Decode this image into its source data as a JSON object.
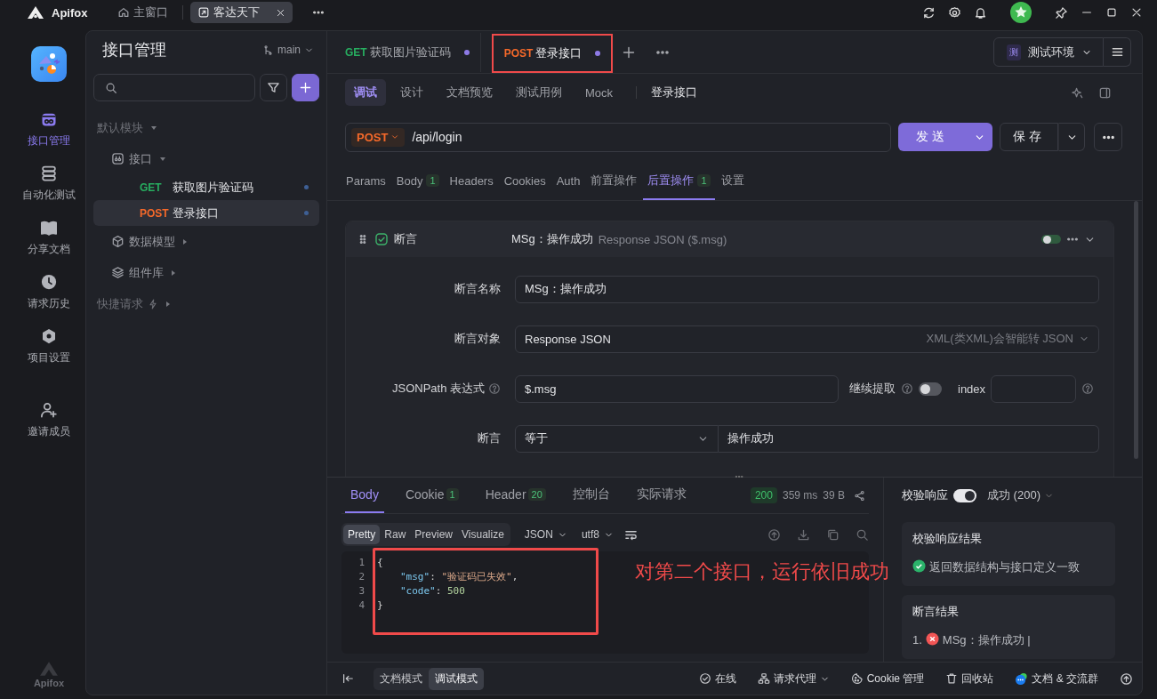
{
  "titlebar": {
    "app_name": "Apifox",
    "tabs": [
      {
        "label": "主窗口",
        "kind": "home",
        "selected": false,
        "closable": false
      },
      {
        "label": "客达天下",
        "kind": "project",
        "selected": true,
        "closable": true
      }
    ]
  },
  "rail": {
    "items": [
      {
        "label": "接口管理",
        "kind": "api",
        "selected": true
      },
      {
        "label": "自动化测试",
        "kind": "automation",
        "selected": false
      },
      {
        "label": "分享文档",
        "kind": "docs",
        "selected": false
      },
      {
        "label": "请求历史",
        "kind": "history",
        "selected": false
      },
      {
        "label": "项目设置",
        "kind": "settings",
        "selected": false
      },
      {
        "label": "邀请成员",
        "kind": "invite",
        "selected": false
      }
    ],
    "footer": "Apifox"
  },
  "sidebar": {
    "title": "接口管理",
    "branch": "main",
    "tree": [
      {
        "label": "默认模块",
        "kind": "module",
        "expanded": true,
        "children": [
          {
            "label": "接口",
            "kind": "folder",
            "expanded": true,
            "children": [
              {
                "label": "获取图片验证码",
                "kind": "endpoint",
                "method": "GET",
                "color": "#27ae60",
                "selected": false
              },
              {
                "label": "登录接口",
                "kind": "endpoint",
                "method": "POST",
                "color": "#f5692a",
                "selected": true
              }
            ]
          },
          {
            "label": "数据模型",
            "kind": "models",
            "expanded": false
          },
          {
            "label": "组件库",
            "kind": "components",
            "expanded": false
          }
        ]
      },
      {
        "label": "快捷请求",
        "kind": "quick",
        "expanded": false
      }
    ]
  },
  "request_tabs": [
    {
      "method": "GET",
      "color": "#27ae60",
      "label": "获取图片验证码",
      "selected": false,
      "unsaved": true,
      "highlighted": false
    },
    {
      "method": "POST",
      "color": "#f5692a",
      "label": "登录接口",
      "selected": true,
      "unsaved": true,
      "highlighted": true
    }
  ],
  "environment": {
    "badge": "测",
    "label": "测试环境"
  },
  "view_tabs": [
    {
      "label": "调试",
      "selected": true
    },
    {
      "label": "设计",
      "selected": false
    },
    {
      "label": "文档预览",
      "selected": false
    },
    {
      "label": "测试用例",
      "selected": false
    },
    {
      "label": "Mock",
      "selected": false
    }
  ],
  "endpoint_name": "登录接口",
  "request": {
    "method": "POST",
    "color": "#f5692a",
    "url": "/api/login",
    "send": "发送",
    "save": "保存"
  },
  "param_tabs": [
    {
      "label": "Params",
      "selected": false
    },
    {
      "label": "Body",
      "count": "1",
      "selected": false
    },
    {
      "label": "Headers",
      "selected": false
    },
    {
      "label": "Cookies",
      "selected": false
    },
    {
      "label": "Auth",
      "selected": false
    },
    {
      "label": "前置操作",
      "selected": false
    },
    {
      "label": "后置操作",
      "count": "1",
      "selected": true
    },
    {
      "label": "设置",
      "selected": false
    }
  ],
  "assertion": {
    "checked": true,
    "title": "断言",
    "summary_name": "MSg：操作成功",
    "summary_target": "Response JSON ($.msg)",
    "on": false,
    "fields": [
      {
        "kind": "text",
        "label": "断言名称",
        "value": "MSg：操作成功"
      },
      {
        "kind": "select",
        "label": "断言对象",
        "value": "Response JSON",
        "hint": "XML(类XML)会智能转 JSON"
      },
      {
        "kind": "jsonpath",
        "label": "JSONPath 表达式",
        "value": "$.msg",
        "extract_label": "继续提取",
        "extract_on": false,
        "index_label": "index"
      },
      {
        "kind": "compare",
        "label": "断言",
        "operator": "等于",
        "value": "操作成功"
      }
    ]
  },
  "response": {
    "tabs": [
      {
        "label": "Body",
        "selected": true
      },
      {
        "label": "Cookie",
        "count": "1",
        "selected": false
      },
      {
        "label": "Header",
        "count": "20",
        "selected": false
      },
      {
        "label": "控制台",
        "selected": false
      },
      {
        "label": "实际请求",
        "selected": false
      }
    ],
    "status": "200",
    "time": "359 ms",
    "size": "39 B",
    "view_modes": [
      {
        "label": "Pretty",
        "selected": true
      },
      {
        "label": "Raw",
        "selected": false
      },
      {
        "label": "Preview",
        "selected": false
      },
      {
        "label": "Visualize",
        "selected": false
      }
    ],
    "format": "JSON",
    "encoding": "utf8",
    "highlighted": true,
    "code_lines": [
      {
        "number": "1",
        "indented": false,
        "tokens": [
          {
            "kind": "punct",
            "text": "{"
          }
        ]
      },
      {
        "number": "2",
        "indented": true,
        "tokens": [
          {
            "kind": "key",
            "text": "\"msg\""
          },
          {
            "kind": "punct",
            "text": ": "
          },
          {
            "kind": "string",
            "text": "\"验证码已失效\""
          },
          {
            "kind": "punct",
            "text": ","
          }
        ]
      },
      {
        "number": "3",
        "indented": true,
        "tokens": [
          {
            "kind": "key",
            "text": "\"code\""
          },
          {
            "kind": "punct",
            "text": ": "
          },
          {
            "kind": "number",
            "text": "500"
          }
        ]
      },
      {
        "number": "4",
        "indented": false,
        "tokens": [
          {
            "kind": "punct",
            "text": "}"
          }
        ]
      }
    ]
  },
  "annotation": "对第二个接口，运行依旧成功",
  "validation": {
    "label": "校验响应",
    "on": true,
    "result": "成功 (200)",
    "cards": [
      {
        "title": "校验响应结果",
        "items": [
          {
            "kind": "pass",
            "text": "返回数据结构与接口定义一致"
          }
        ]
      },
      {
        "title": "断言结果",
        "items": [
          {
            "kind": "fail",
            "number": "1.",
            "text": "MSg：操作成功 |"
          }
        ]
      }
    ]
  },
  "bottom_bar": {
    "modes": [
      {
        "label": "文档模式",
        "selected": false
      },
      {
        "label": "调试模式",
        "selected": true
      }
    ],
    "items": [
      {
        "kind": "online",
        "label": "在线",
        "dropdown": false
      },
      {
        "kind": "proxy",
        "label": "请求代理",
        "dropdown": true
      },
      {
        "kind": "cookie",
        "label": "Cookie 管理",
        "dropdown": false
      },
      {
        "kind": "trash",
        "label": "回收站",
        "dropdown": false
      },
      {
        "kind": "chat",
        "label": "文档 & 交流群",
        "dropdown": false
      }
    ]
  }
}
